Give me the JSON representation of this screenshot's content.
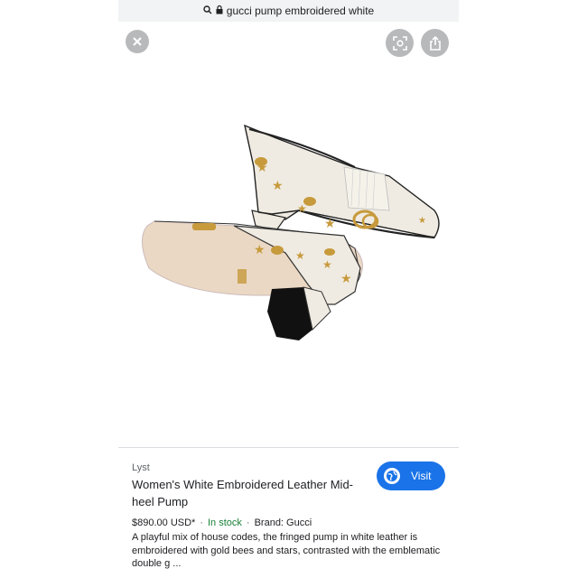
{
  "url_bar": {
    "text": "gucci pump embroidered white"
  },
  "image_controls": {
    "close": "close-icon",
    "lens": "lens-icon",
    "share": "share-icon"
  },
  "result": {
    "source": "Lyst",
    "title": "Women's White Embroidered Leather Mid-heel Pump",
    "visit_label": "Visit",
    "price": "$890.00 USD*",
    "stock": "In stock",
    "brand": "Brand: Gucci",
    "description": "A playful mix of house codes, the fringed pump in white leather is embroidered with gold bees and stars, contrasted with the emblematic double g ..."
  },
  "colors": {
    "accent": "#1a73e8",
    "stock": "#188038",
    "shoe": "#efebe2",
    "gold": "#c79a3c"
  }
}
